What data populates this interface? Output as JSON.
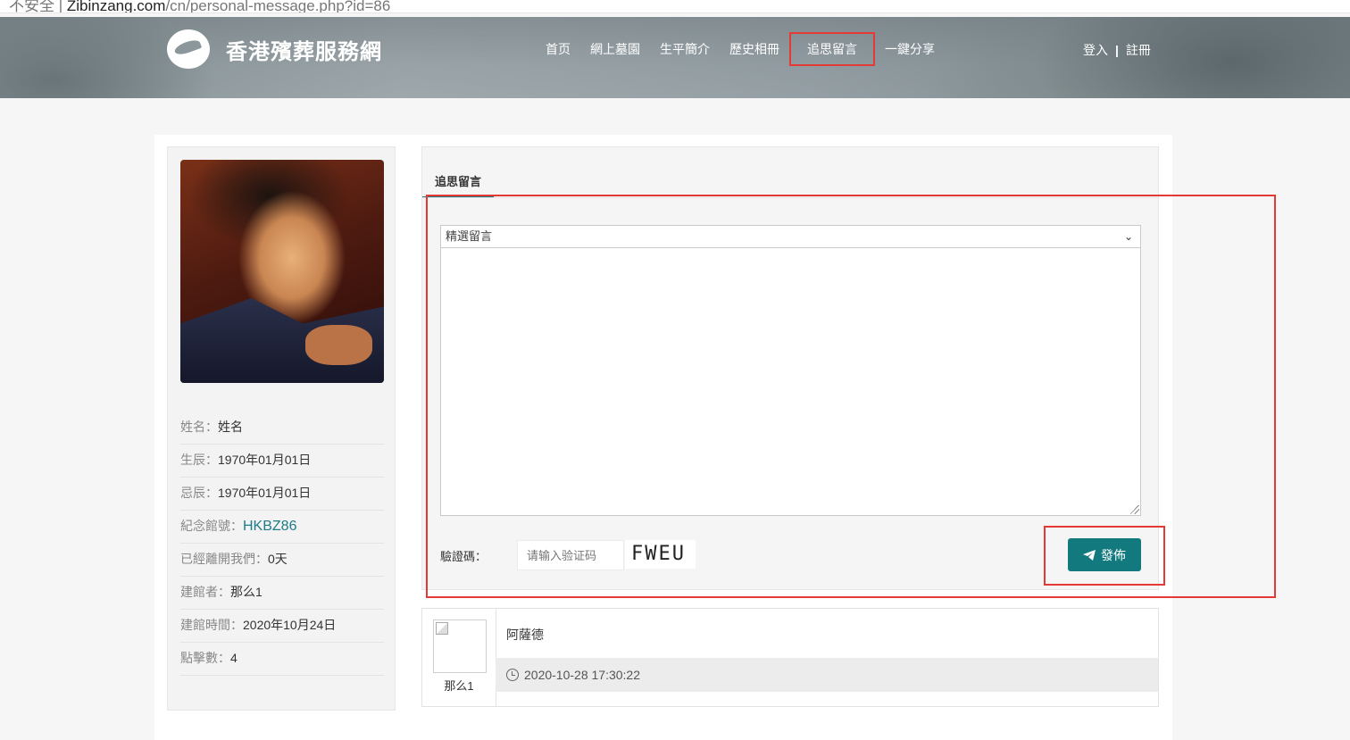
{
  "browser": {
    "url_prefix": "不安全 | ",
    "url_host": "Zibinzang.com",
    "url_path": "/cn/personal-message.php?id=86"
  },
  "site": {
    "logo_text": "香港殯葬服務網"
  },
  "nav": {
    "items": [
      {
        "label": "首页",
        "active": false
      },
      {
        "label": "網上墓園",
        "active": false
      },
      {
        "label": "生平簡介",
        "active": false
      },
      {
        "label": "歷史相冊",
        "active": false
      },
      {
        "label": "追思留言",
        "active": true
      },
      {
        "label": "一鍵分享",
        "active": false
      }
    ],
    "login": "登入",
    "separator": "|",
    "register": "註冊"
  },
  "profile": {
    "fields": [
      {
        "key": "姓名：",
        "value": "姓名"
      },
      {
        "key": "生辰：",
        "value": "1970年01月01日"
      },
      {
        "key": "忌辰：",
        "value": "1970年01月01日"
      },
      {
        "key": "紀念館號：",
        "value": "HKBZ86"
      },
      {
        "key": "已經離開我們：",
        "value": "0天"
      },
      {
        "key": "建館者：",
        "value": "那么1"
      },
      {
        "key": "建館時間：",
        "value": "2020年10月24日"
      },
      {
        "key": "點擊數：",
        "value": "4"
      }
    ]
  },
  "message_panel": {
    "tab_label": "追思留言",
    "select_value": "精選留言",
    "captcha_label": "驗證碼：",
    "captcha_placeholder": "请输入验证码",
    "captcha_text": "FWEU",
    "send_label": "發佈"
  },
  "comments": [
    {
      "author": "那么1",
      "text": "阿薩德",
      "time": "2020-10-28 17:30:22"
    }
  ],
  "colors": {
    "accent": "#127a7f",
    "annotation": "#e53935"
  }
}
